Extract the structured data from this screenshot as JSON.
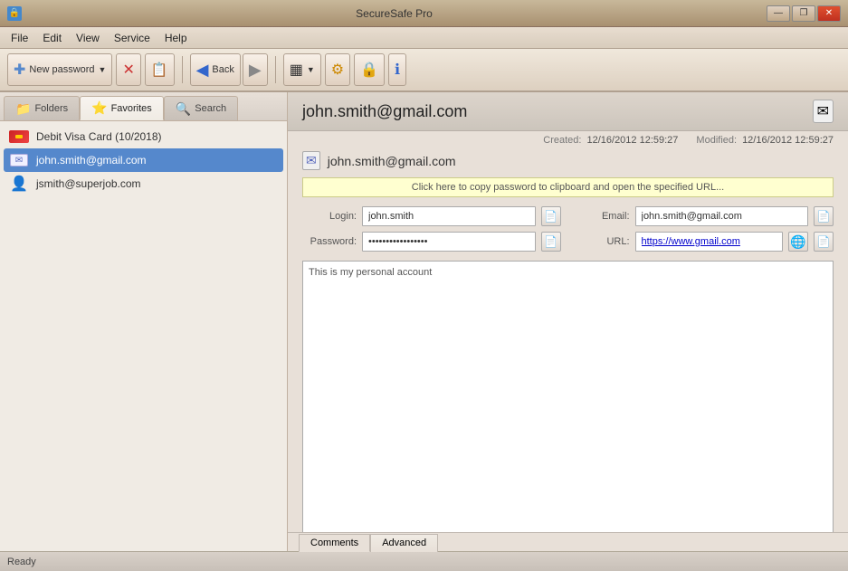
{
  "window": {
    "title": "SecureSafe Pro",
    "icon": "🔒"
  },
  "window_controls": {
    "minimize": "—",
    "restore": "❐",
    "close": "✕"
  },
  "menu": {
    "items": [
      "File",
      "Edit",
      "View",
      "Service",
      "Help"
    ]
  },
  "toolbar": {
    "new_password": "New password",
    "back": "Back",
    "dropdown_arrow": "▼"
  },
  "sidebar": {
    "tabs": [
      {
        "id": "folders",
        "label": "Folders",
        "icon": "📁"
      },
      {
        "id": "favorites",
        "label": "Favorites",
        "icon": "⭐"
      },
      {
        "id": "search",
        "label": "Search",
        "icon": "🔍"
      }
    ],
    "items": [
      {
        "id": "debit-visa",
        "label": "Debit Visa Card (10/2018)",
        "type": "card"
      },
      {
        "id": "john-gmail",
        "label": "john.smith@gmail.com",
        "type": "email",
        "selected": true
      },
      {
        "id": "jsmith-superjob",
        "label": "jsmith@superjob.com",
        "type": "user"
      }
    ]
  },
  "content": {
    "title": "john.smith@gmail.com",
    "created_label": "Created:",
    "created_value": "12/16/2012 12:59:27",
    "modified_label": "Modified:",
    "modified_value": "12/16/2012 12:59:27",
    "entry_name": "john.smith@gmail.com",
    "clipboard_bar": "Click here to copy password to clipboard and open the specified URL...",
    "login_label": "Login:",
    "login_value": "john.smith",
    "email_label": "Email:",
    "email_value": "john.smith@gmail.com",
    "password_label": "Password:",
    "password_value": "••••••••••••••••",
    "url_label": "URL:",
    "url_value": "https://www.gmail.com",
    "comments": "This is my personal account",
    "tabs": [
      {
        "id": "comments",
        "label": "Comments",
        "active": true
      },
      {
        "id": "advanced",
        "label": "Advanced"
      }
    ]
  },
  "status": {
    "text": "Ready"
  }
}
